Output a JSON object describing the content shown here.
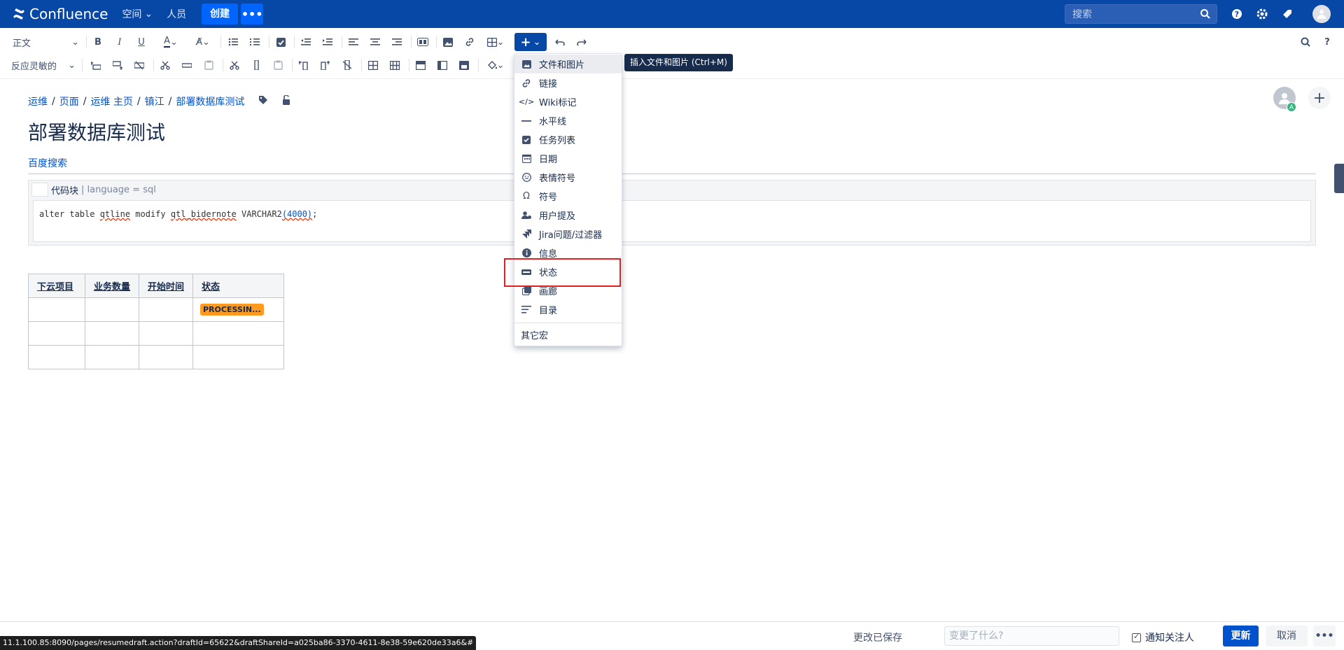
{
  "topnav": {
    "logo_text": "Confluence",
    "spaces_label": "空间",
    "people_label": "人员",
    "create_label": "创建",
    "more_label": "•••",
    "search_placeholder": "搜索"
  },
  "toolbar": {
    "paragraph_style": "正文",
    "layout_style": "反应灵敏的"
  },
  "breadcrumb": [
    "运维",
    "页面",
    "运维 主页",
    "镇江",
    "部署数据库测试"
  ],
  "page": {
    "title": "部署数据库测试",
    "link_text": "百度搜索"
  },
  "code_macro": {
    "header_label": "代码块",
    "header_params": "| language = sql",
    "code_prefix": "alter table ",
    "code_t1": "qtline",
    "code_mid": " modify ",
    "code_t2": "qtl_bidernote",
    "code_type": " VARCHAR2",
    "code_t3": "(4000)",
    "code_end": ";"
  },
  "table": {
    "headers": [
      "下云项目",
      "业务数量",
      "开始时间",
      "状态"
    ],
    "status_text": "PROCESSIN..."
  },
  "insert_menu": {
    "items": [
      {
        "label": "文件和图片",
        "icon": "image-icon"
      },
      {
        "label": "链接",
        "icon": "link-icon"
      },
      {
        "label": "Wiki标记",
        "icon": "code-icon"
      },
      {
        "label": "水平线",
        "icon": "horizontal-rule-icon"
      },
      {
        "label": "任务列表",
        "icon": "checkbox-icon"
      },
      {
        "label": "日期",
        "icon": "calendar-icon"
      },
      {
        "label": "表情符号",
        "icon": "emoji-icon"
      },
      {
        "label": "符号",
        "icon": "omega-icon"
      },
      {
        "label": "用户提及",
        "icon": "user-mention-icon"
      },
      {
        "label": "Jira问题/过滤器",
        "icon": "jira-icon"
      },
      {
        "label": "信息",
        "icon": "info-icon"
      },
      {
        "label": "状态",
        "icon": "status-icon"
      },
      {
        "label": "画廊",
        "icon": "gallery-icon"
      },
      {
        "label": "目录",
        "icon": "toc-icon"
      }
    ],
    "other_macros": "其它宏"
  },
  "tooltip": "插入文件和图片 (Ctrl+M)",
  "footer": {
    "saved_text": "更改已保存",
    "change_placeholder": "变更了什么?",
    "notify_label": "通知关注人",
    "update_label": "更新",
    "cancel_label": "取消",
    "more_label": "•••"
  },
  "statusbar_url": "11.1.100.85:8090/pages/resumedraft.action?draftId=65622&draftShareId=a025ba86-3370-4611-8e38-59e620de33a6&#",
  "avatar_badge": "A",
  "add_label": "+"
}
